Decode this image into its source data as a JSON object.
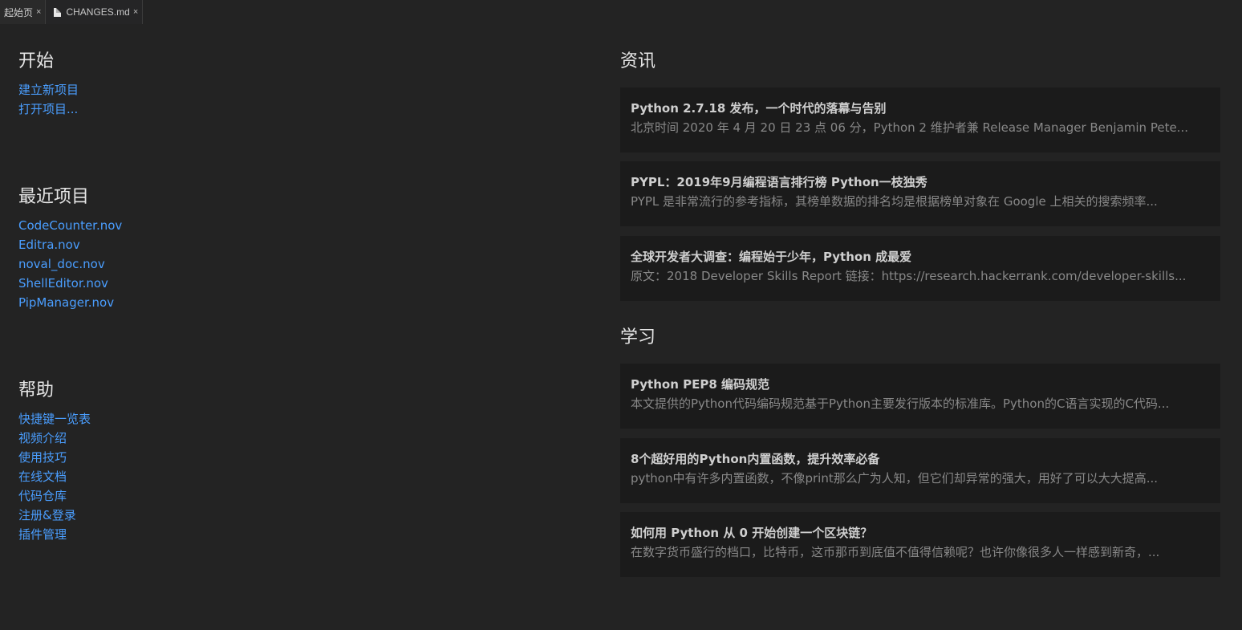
{
  "tabs": [
    {
      "label": "起始页",
      "close": "×"
    },
    {
      "label": "CHANGES.md",
      "close": "×"
    }
  ],
  "start": {
    "title": "开始",
    "links": [
      "建立新项目",
      "打开项目..."
    ]
  },
  "recent": {
    "title": "最近项目",
    "links": [
      "CodeCounter.nov",
      "Editra.nov",
      "noval_doc.nov",
      "ShellEditor.nov",
      "PipManager.nov"
    ]
  },
  "help": {
    "title": "帮助",
    "links": [
      "快捷键一览表",
      "视频介绍",
      "使用技巧",
      "在线文档",
      "代码仓库",
      "注册&登录",
      "插件管理"
    ]
  },
  "news": {
    "title": "资讯",
    "items": [
      {
        "title": "Python 2.7.18 发布，一个时代的落幕与告别",
        "desc": "北京时间 2020 年 4 月 20 日 23 点 06 分，Python 2 维护者兼 Release Manager Benjamin Pete..."
      },
      {
        "title": "PYPL：2019年9月编程语言排行榜 Python一枝独秀",
        "desc": "PYPL 是非常流行的参考指标，其榜单数据的排名均是根据榜单对象在 Google 上相关的搜索频率..."
      },
      {
        "title": "全球开发者大调查：编程始于少年，Python 成最爱",
        "desc": "原文：2018 Developer Skills Report 链接：https://research.hackerrank.com/developer-skills..."
      }
    ]
  },
  "learn": {
    "title": "学习",
    "items": [
      {
        "title": "Python PEP8 编码规范",
        "desc": "本文提供的Python代码编码规范基于Python主要发行版本的标准库。Python的C语言实现的C代码..."
      },
      {
        "title": "8个超好用的Python内置函数，提升效率必备",
        "desc": "python中有许多内置函数，不像print那么广为人知，但它们却异常的强大，用好了可以大大提高..."
      },
      {
        "title": "如何用 Python 从 0 开始创建一个区块链？",
        "desc": "在数字货币盛行的档口，比特币，这币那币到底值不值得信赖呢？也许你像很多人一样感到新奇，..."
      }
    ]
  }
}
